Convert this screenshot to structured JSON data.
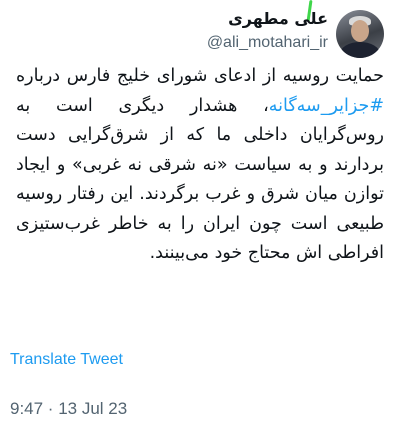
{
  "author": {
    "display_name": "علی مطهری",
    "handle": "@ali_motahari_ir"
  },
  "tweet": {
    "text_before": "حمایت روسیه از ادعای شورای خلیج فارس درباره ",
    "hashtag": "#جزایر_سه‌گانه",
    "text_after": "، هشدار دیگری است به روس‌گرایان داخلی ما که از شرق‌گرایی دست بردارند و به سیاست «نه شرقی نه غربی» و ایجاد توازن میان شرق و غرب برگردند. این رفتار روسیه طبیعی است چون ایران را به خاطر غرب‌ستیزی افراطی اش محتاج خود می‌بینند."
  },
  "translate_label": "Translate Tweet",
  "timestamp": "9:47 · 13 Jul 23",
  "colors": {
    "link": "#1d9bf0",
    "secondary_text": "#536471",
    "primary_text": "#0f1419",
    "annotation_mark": "#3fd64a"
  }
}
